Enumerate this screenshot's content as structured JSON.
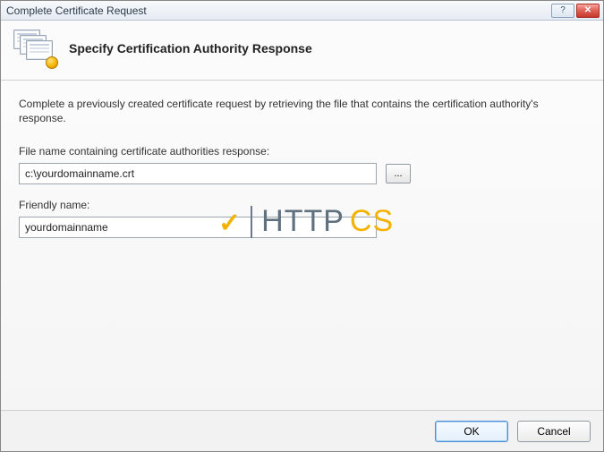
{
  "window": {
    "title": "Complete Certificate Request"
  },
  "header": {
    "heading": "Specify Certification Authority Response"
  },
  "body": {
    "description": "Complete a previously created certificate request by retrieving the file that contains the certification authority's response.",
    "file_label": "File name containing certificate authorities response:",
    "file_value": "c:\\yourdomainname.crt",
    "browse_label": "...",
    "friendly_label": "Friendly name:",
    "friendly_value": "yourdomainname"
  },
  "watermark": {
    "check": "✓",
    "part1": "HTTP",
    "part2": "CS"
  },
  "footer": {
    "ok": "OK",
    "cancel": "Cancel"
  }
}
